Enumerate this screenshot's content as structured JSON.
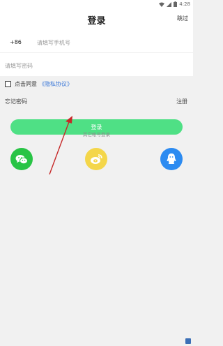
{
  "status_bar": {
    "time": "4:28"
  },
  "header": {
    "title": "登录",
    "skip": "跳过"
  },
  "form": {
    "country_code": "+86",
    "phone_placeholder": "请填写手机号",
    "password_placeholder": "请填写密码",
    "agree_text": "点击同意",
    "privacy_link": "《隐私协议》",
    "forgot_password": "忘记密码",
    "register": "注册",
    "login_button": "登录"
  },
  "social": {
    "label": "其它帐号登录",
    "items": [
      {
        "name": "wechat",
        "color": "#28c445"
      },
      {
        "name": "weibo",
        "color": "#f4d64a"
      },
      {
        "name": "qq",
        "color": "#2c8bf1"
      }
    ]
  },
  "colors": {
    "accent": "#4fe085",
    "link": "#3b78d8",
    "background": "#f1f1f1"
  }
}
